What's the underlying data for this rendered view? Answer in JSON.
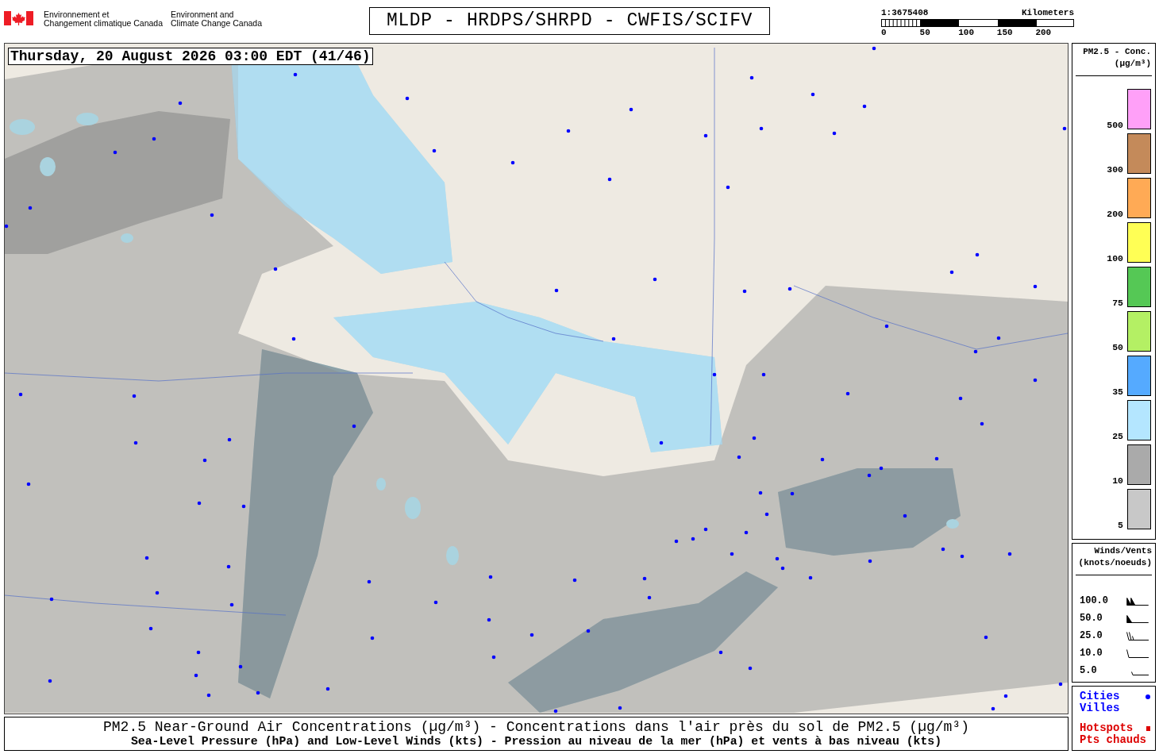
{
  "header": {
    "wordmarks": [
      {
        "lines": [
          "Environnement et",
          "Changement climatique Canada"
        ]
      },
      {
        "lines": [
          "Environment and",
          "Climate Change Canada"
        ]
      }
    ],
    "title": "MLDP - HRDPS/SHRPD - CWFIS/SCIFV",
    "scale": {
      "ratio": "1:3675408",
      "unit": "Kilometers",
      "ticks": [
        "0",
        "50",
        "100",
        "150",
        "200"
      ]
    }
  },
  "map": {
    "timestamp": "Thursday, 20 August 2026 03:00 EDT (41/46)"
  },
  "pm25_legend": {
    "title": "PM2.5 - Conc.",
    "unit": "(µg/m³)",
    "bins": [
      {
        "label": "500",
        "color": "#ffa0f8"
      },
      {
        "label": "300",
        "color": "#c48a5a"
      },
      {
        "label": "200",
        "color": "#ffaa55"
      },
      {
        "label": "100",
        "color": "#ffff55"
      },
      {
        "label": "75",
        "color": "#55c855"
      },
      {
        "label": "50",
        "color": "#b4f064"
      },
      {
        "label": "35",
        "color": "#55aaff"
      },
      {
        "label": "25",
        "color": "#b4e6ff"
      },
      {
        "label": "10",
        "color": "#aaaaaa"
      },
      {
        "label": "5",
        "color": "#c8c8c8"
      }
    ]
  },
  "wind_legend": {
    "title": "Winds/Vents",
    "unit": "(knots/noeuds)",
    "rows": [
      {
        "label": "100.0",
        "kind": "pennants"
      },
      {
        "label": "50.0",
        "kind": "pennant"
      },
      {
        "label": "25.0",
        "kind": "barbs"
      },
      {
        "label": "10.0",
        "kind": "barb"
      },
      {
        "label": "5.0",
        "kind": "halfbarb"
      }
    ]
  },
  "symbol_legend": {
    "items": [
      {
        "lines": [
          "Cities",
          "Villes"
        ],
        "color": "#0000ff",
        "kind": "dot"
      },
      {
        "lines": [
          "Hotspots",
          "Pts chauds"
        ],
        "color": "#dd0000",
        "kind": "square"
      }
    ]
  },
  "caption": {
    "lines": [
      "PM2.5 Near-Ground Air Concentrations (µg/m³) - Concentrations dans l'air près du sol de PM2.5 (µg/m³)",
      "Sea-Level Pressure (hPa) and Low-Level Winds (kts) - Pression au niveau de la mer (hPa) et vents à bas niveau (kts)"
    ]
  }
}
